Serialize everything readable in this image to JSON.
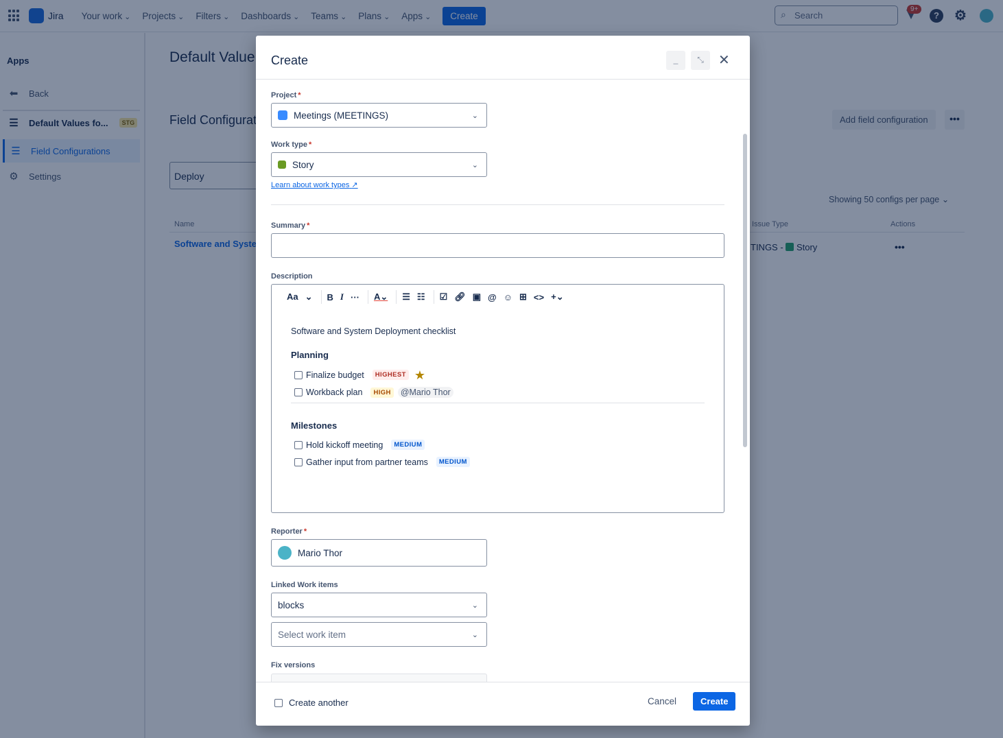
{
  "nav": {
    "brand": "Jira",
    "items": [
      "Your work",
      "Projects",
      "Filters",
      "Dashboards",
      "Teams",
      "Plans",
      "Apps"
    ],
    "create": "Create",
    "search_placeholder": "Search",
    "notif_count": "9+"
  },
  "sidebar": {
    "heading": "Apps",
    "back": "Back",
    "app": "Default Values fo...",
    "app_badge": "STG",
    "field_configs": "Field Configurations",
    "settings": "Settings"
  },
  "page": {
    "title": "Default Value",
    "subtitle": "Field Configurat",
    "filter": "Deploy",
    "add_btn": "Add field configuration",
    "per_page": "Showing 50 configs per page",
    "col_name": "Name",
    "col_issue_type": "Issue Type",
    "col_actions": "Actions",
    "row_name": "Software and Syste",
    "row_project": "TINGS",
    "row_dash": "-",
    "row_type": "Story"
  },
  "modal": {
    "title": "Create",
    "project": {
      "label": "Project",
      "value": "Meetings (MEETINGS)"
    },
    "work_type": {
      "label": "Work type",
      "value": "Story",
      "link": "Learn about work types"
    },
    "summary": {
      "label": "Summary",
      "value": ""
    },
    "description": {
      "label": "Description",
      "toolbar_text": "Aa",
      "intro": "Software and System Deployment checklist",
      "sections": [
        {
          "heading": "Planning",
          "items": [
            {
              "text": "Finalize budget",
              "lozenge": "HIGHEST"
            },
            {
              "text": "Workback plan",
              "lozenge": "HIGH",
              "mention": "@Mario Thor"
            }
          ]
        },
        {
          "heading": "Milestones",
          "items": [
            {
              "text": "Hold kickoff meeting",
              "lozenge": "MEDIUM"
            },
            {
              "text": "Gather input from partner teams",
              "lozenge": "MEDIUM"
            }
          ]
        }
      ]
    },
    "reporter": {
      "label": "Reporter",
      "value": "Mario Thor"
    },
    "linked": {
      "label": "Linked Work items",
      "relation": "blocks",
      "placeholder": "Select work item"
    },
    "fix_versions": {
      "label": "Fix versions"
    },
    "footer": {
      "create_another": "Create another",
      "cancel": "Cancel",
      "create": "Create"
    }
  }
}
